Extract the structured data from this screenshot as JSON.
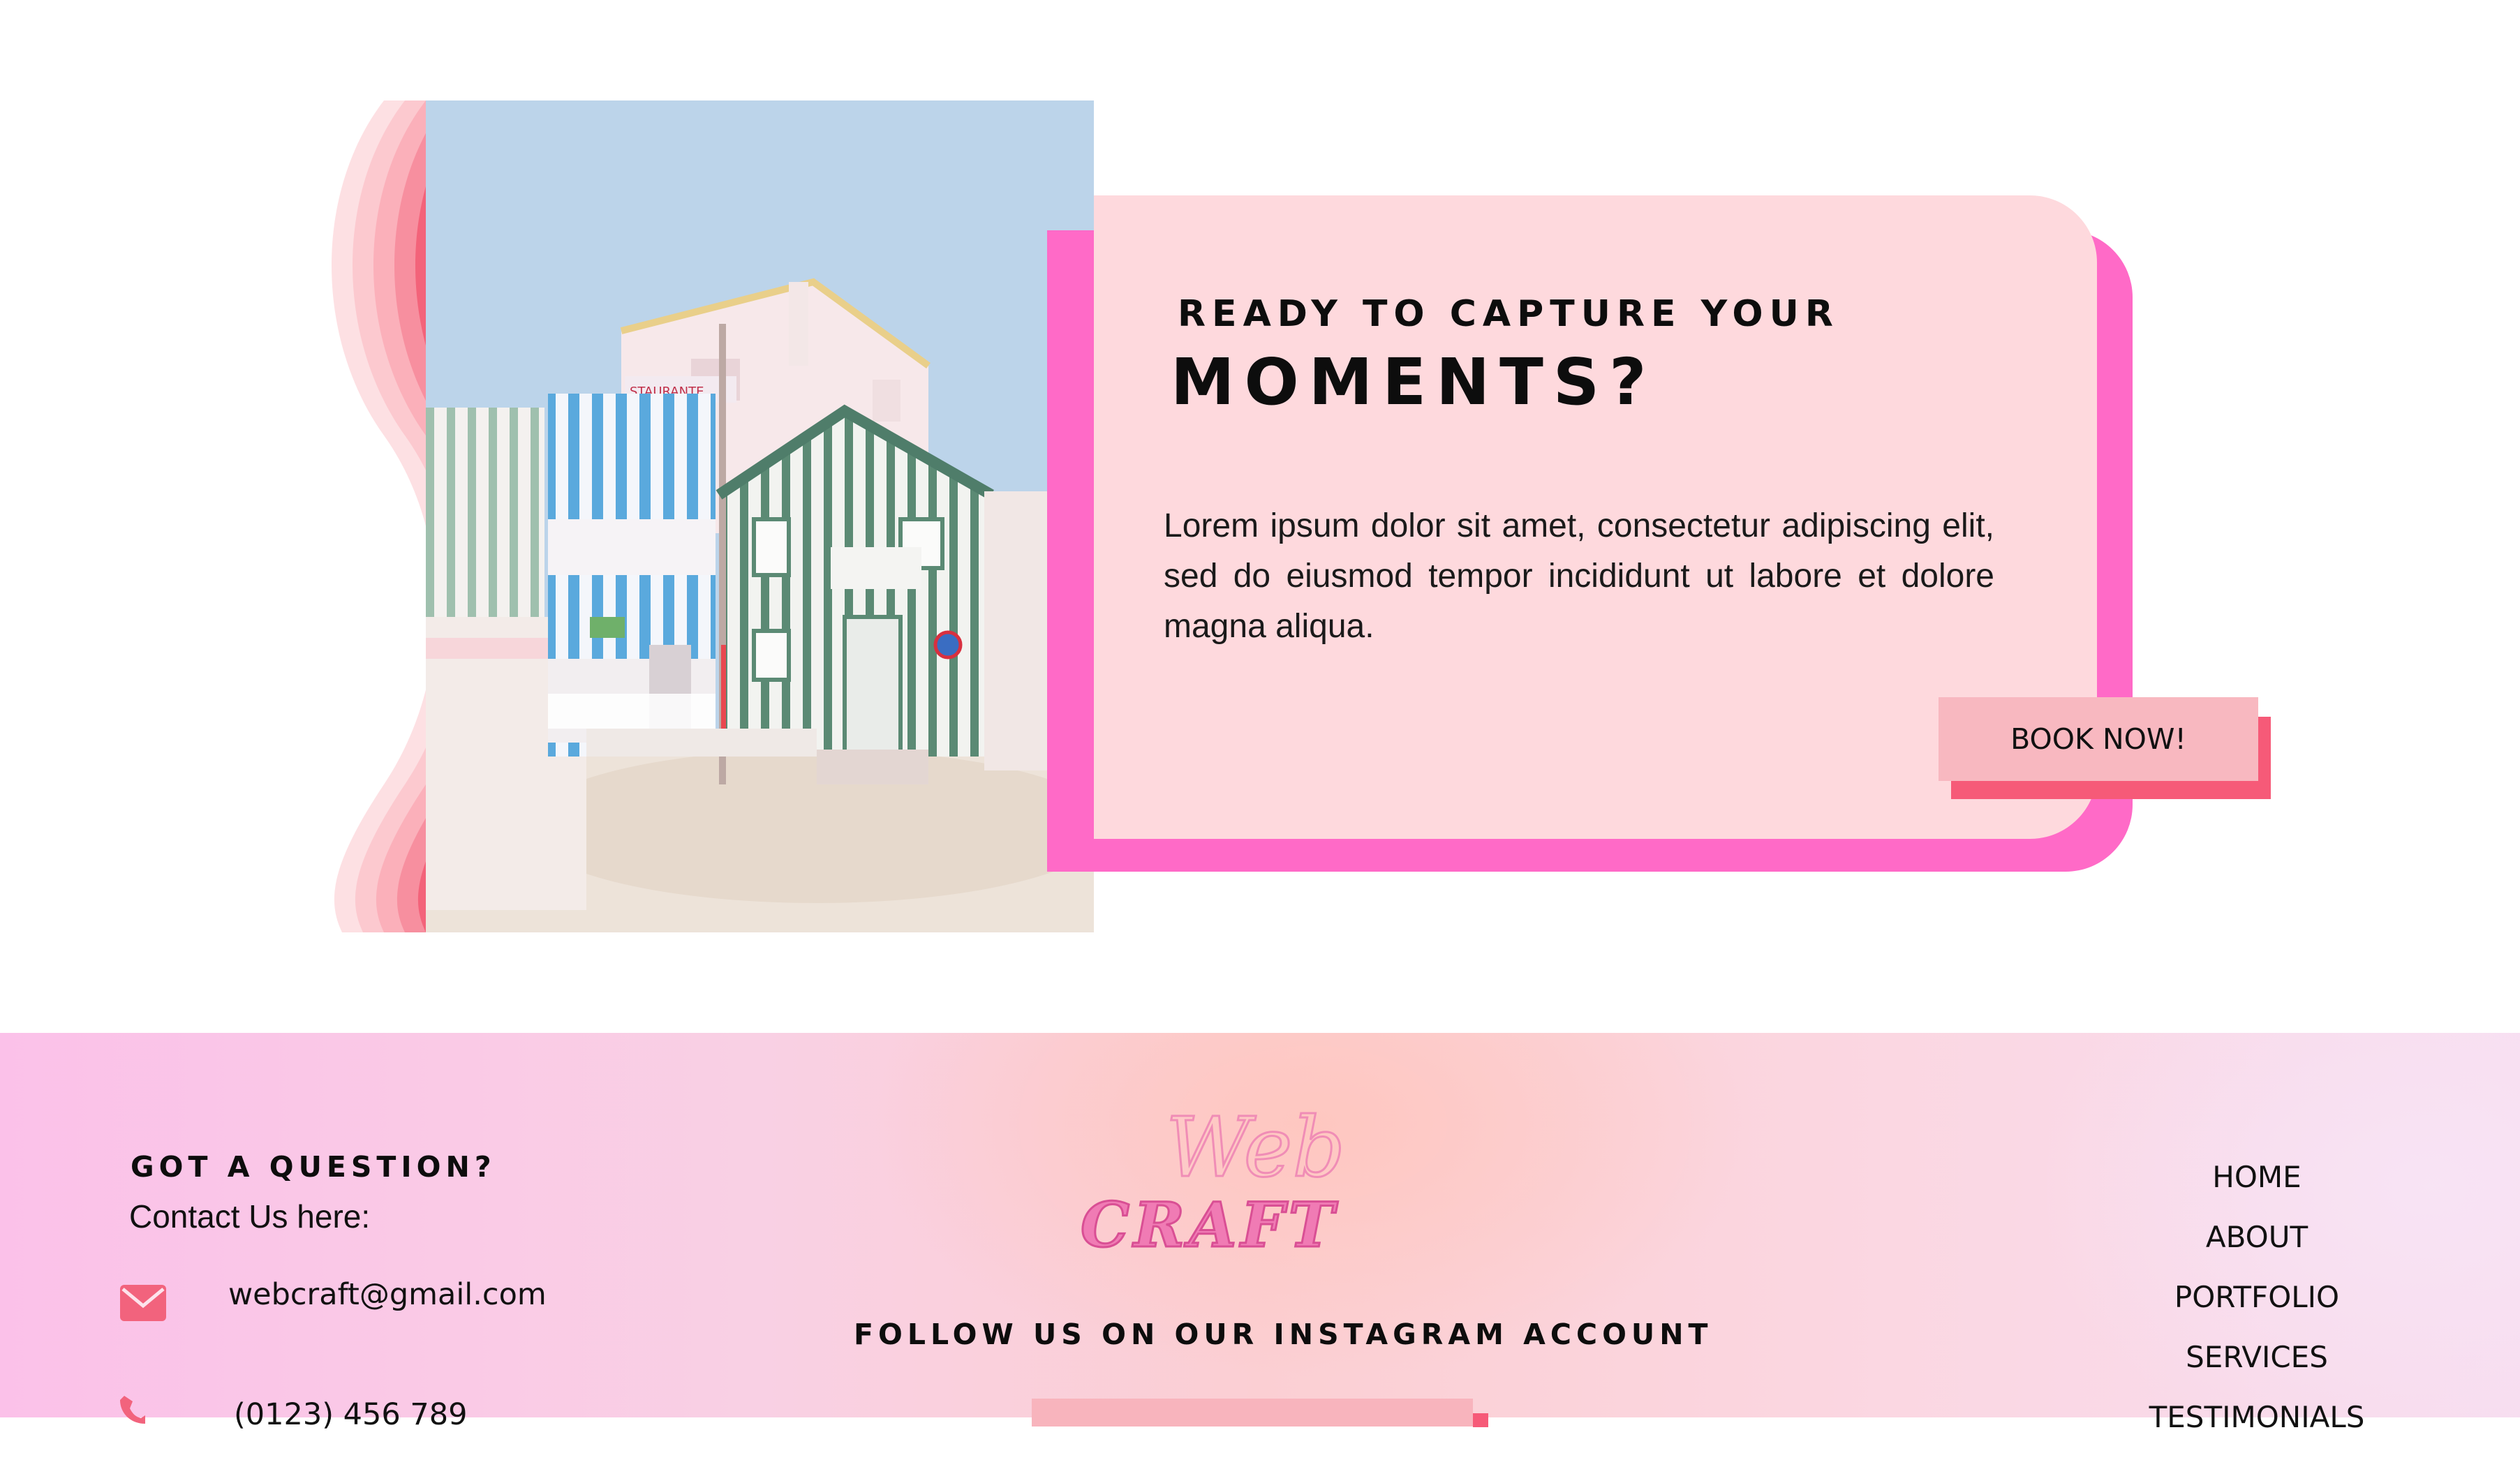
{
  "hero": {
    "kicker": "READY TO CAPTURE YOUR",
    "headline": "MOMENTS?",
    "body": "Lorem ipsum dolor sit amet, consectetur adipiscing elit, sed do eiusmod tempor incididunt ut labore et dolore magna aliqua.",
    "cta_label": "BOOK NOW!",
    "photo_sign_text": "STAURANTE"
  },
  "footer": {
    "question_title": "GOT A QUESTION?",
    "question_sub": "Contact Us here:",
    "email_icon": "envelope-icon",
    "email": "webcraft@gmail.com",
    "phone_icon": "phone-icon",
    "phone": "(0123) 456 789",
    "logo_script": "Web",
    "logo_block": "CRAFT",
    "follow_text": "FOLLOW US ON OUR INSTAGRAM ACCOUNT",
    "nav": [
      "HOME",
      "ABOUT",
      "PORTFOLIO",
      "SERVICES",
      "TESTIMONIALS"
    ]
  },
  "colors": {
    "card_bg": "#fed9dd",
    "card_shadow": "#ff6ac7",
    "button_bg": "#f8b8c0",
    "button_shadow": "#f65a78",
    "wave_stripes": [
      "#fde0e3",
      "#fcc9cf",
      "#fbb0ba",
      "#f78f9f",
      "#f3637a"
    ],
    "logo_pink": "#f07bb4"
  }
}
